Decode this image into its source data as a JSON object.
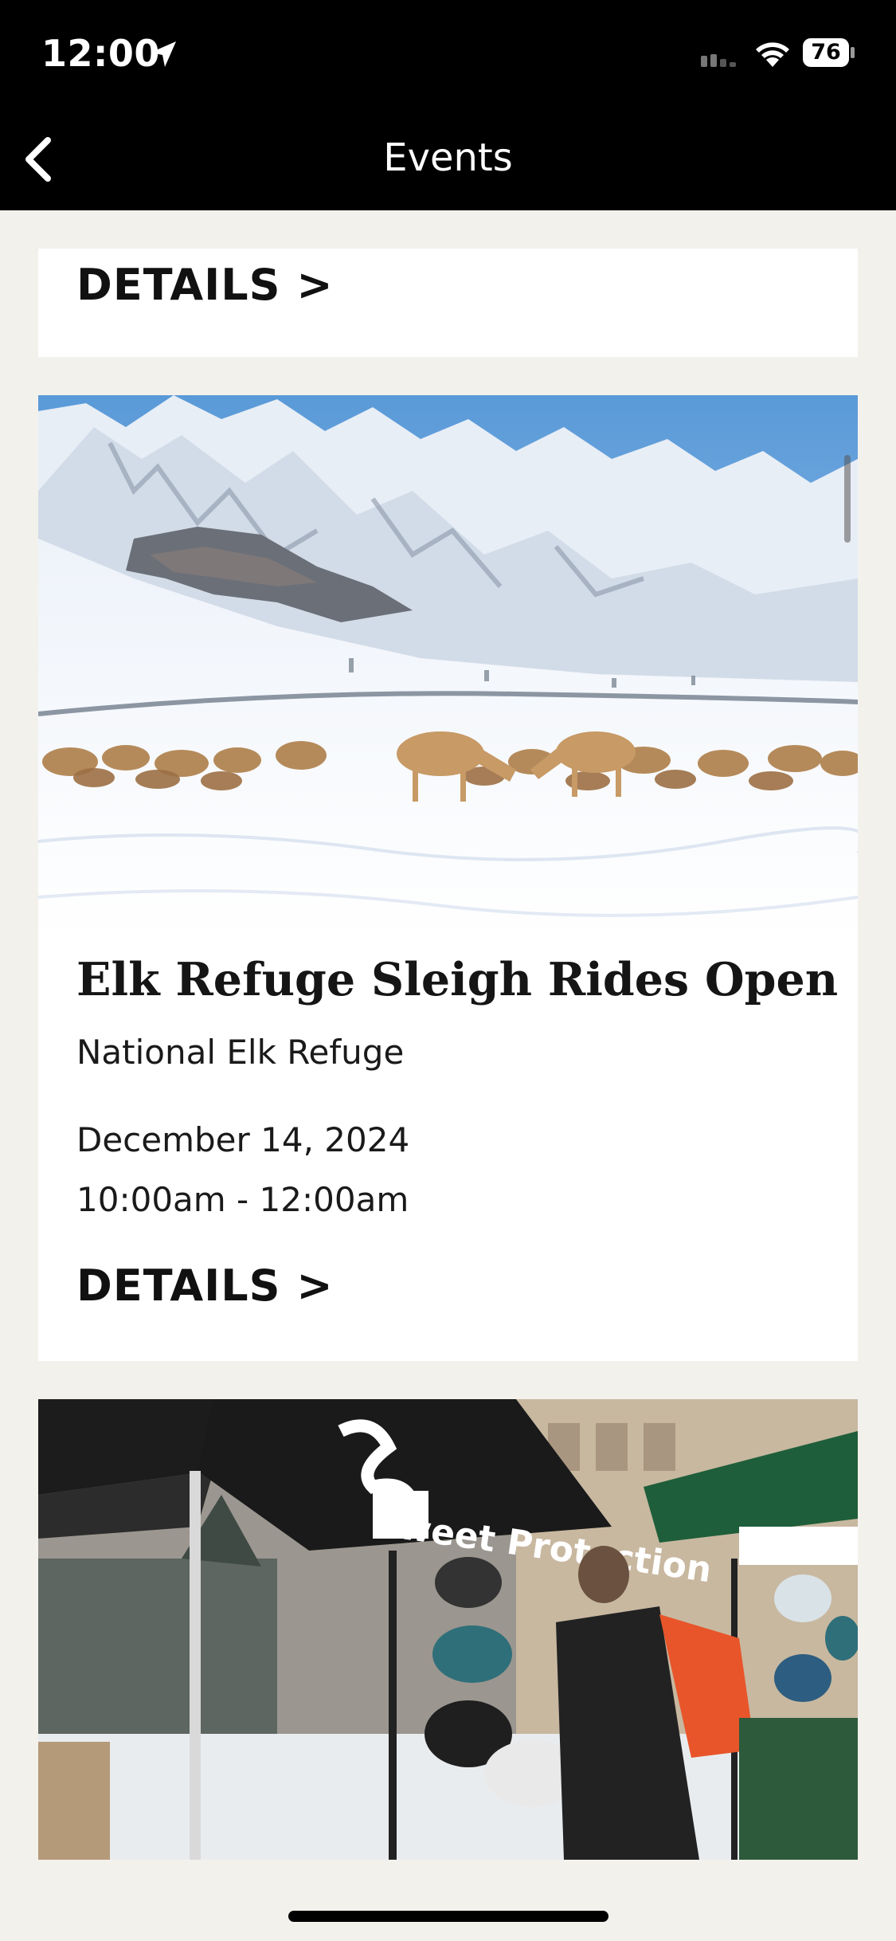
{
  "status_bar": {
    "time": "12:00",
    "battery": "76",
    "icons": [
      "location-arrow-icon",
      "signal-icon",
      "wifi-icon",
      "battery-icon"
    ]
  },
  "nav": {
    "title": "Events",
    "back_icon": "chevron-left-icon"
  },
  "events": [
    {
      "details_label": "DETAILS >"
    },
    {
      "image": "elk herd in snowy valley below mountains",
      "title": "Elk Refuge Sleigh Rides Open For…",
      "venue": "National Elk Refuge",
      "date": "December 14, 2024",
      "time": "10:00am - 12:00am",
      "details_label": "DETAILS >"
    },
    {
      "image": "outdoor gear tents with helmets on display in snow",
      "tent_text": "Sweet Protection"
    }
  ],
  "colors": {
    "header_bg": "#000000",
    "page_bg": "#f3f1ec",
    "card_bg": "#ffffff",
    "text": "#111111"
  }
}
